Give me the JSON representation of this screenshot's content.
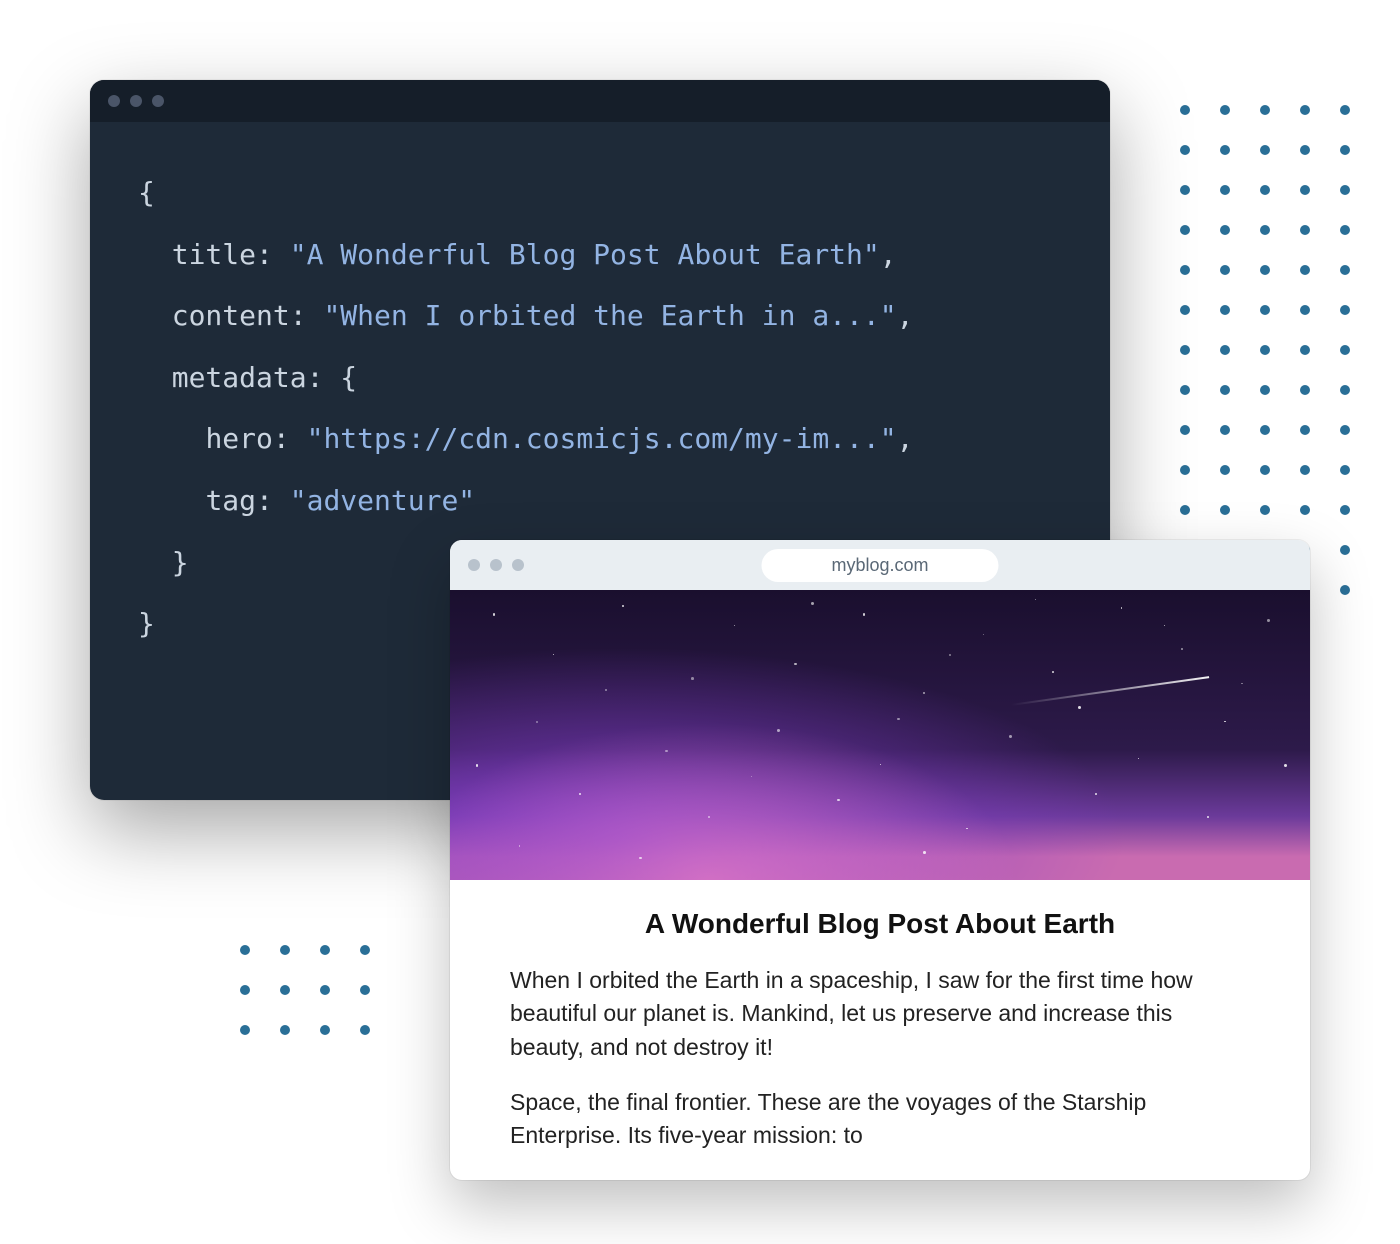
{
  "code_window": {
    "lines": {
      "open_brace": "{",
      "title_key": "title",
      "title_val": "\"A Wonderful Blog Post About Earth\"",
      "content_key": "content",
      "content_val": "\"When I orbited the Earth in a...\"",
      "metadata_key": "metadata",
      "metadata_open": "{",
      "hero_key": "hero",
      "hero_val": "\"https://cdn.cosmicjs.com/my-im...\"",
      "tag_key": "tag",
      "tag_val": "\"adventure\"",
      "metadata_close": "}",
      "close_brace": "}"
    }
  },
  "browser": {
    "url": "myblog.com",
    "blog": {
      "title": "A Wonderful Blog Post About Earth",
      "para1": "When I orbited the Earth in a spaceship, I saw for the first time how beautiful our planet is. Mankind, let us preserve and increase this beauty, and not destroy it!",
      "para2": "Space, the final frontier. These are the voyages of the Starship Enterprise. Its five-year mission: to"
    }
  }
}
